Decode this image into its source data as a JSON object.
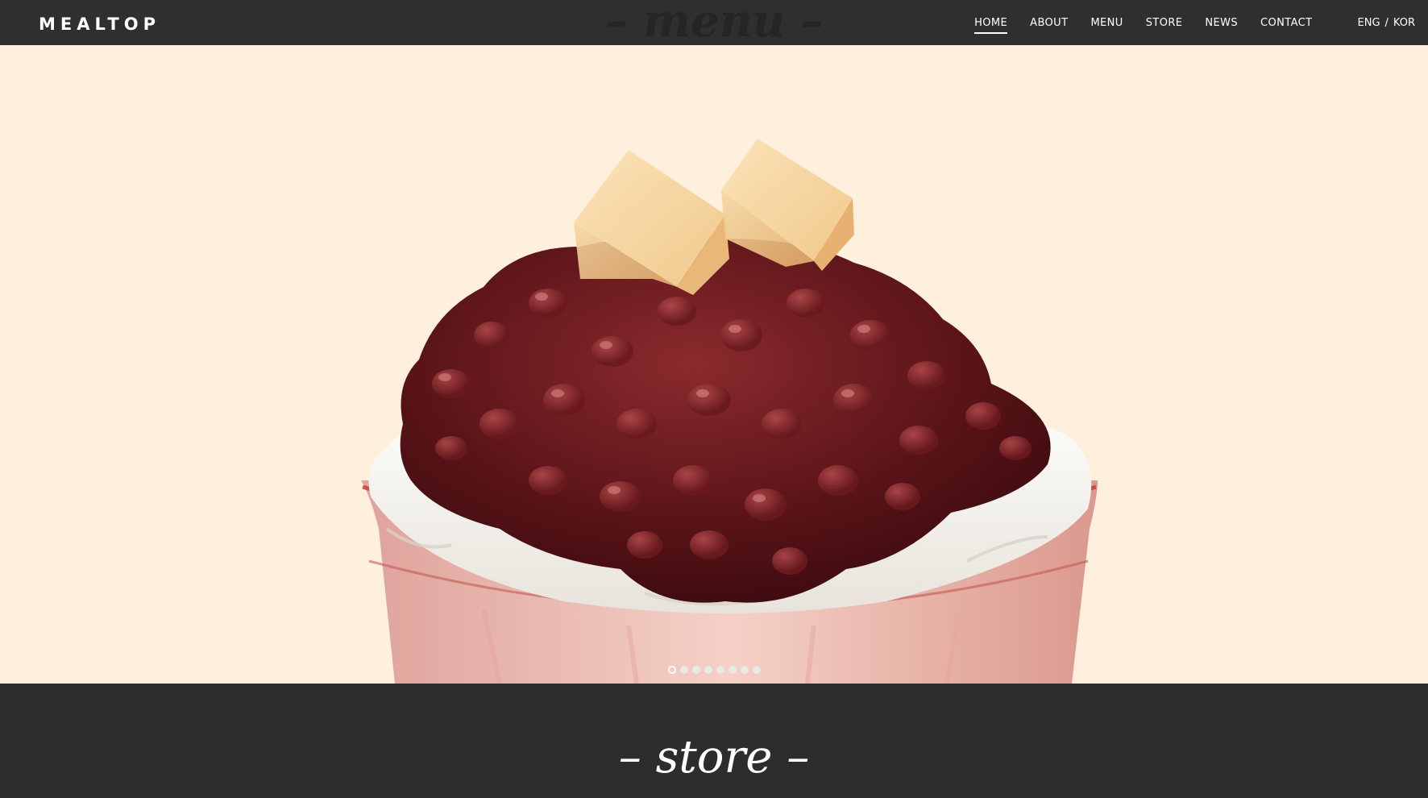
{
  "brand": {
    "logo": "MEALTOP"
  },
  "sections": {
    "menu_heading": "– menu –",
    "store_heading": "– store –"
  },
  "nav": {
    "items": [
      {
        "label": "HOME",
        "active": true
      },
      {
        "label": "ABOUT",
        "active": false
      },
      {
        "label": "MENU",
        "active": false
      },
      {
        "label": "STORE",
        "active": false
      },
      {
        "label": "NEWS",
        "active": false
      },
      {
        "label": "CONTACT",
        "active": false
      }
    ],
    "languages": {
      "eng": "ENG",
      "separator": "/",
      "kor": "KOR"
    }
  },
  "slider": {
    "slide_count": 8,
    "active_index": 0,
    "background_color": "#fef0dd"
  },
  "colors": {
    "header_bg": "#2f2f2f",
    "section_bg": "#2d2d2d",
    "text": "#ffffff"
  }
}
